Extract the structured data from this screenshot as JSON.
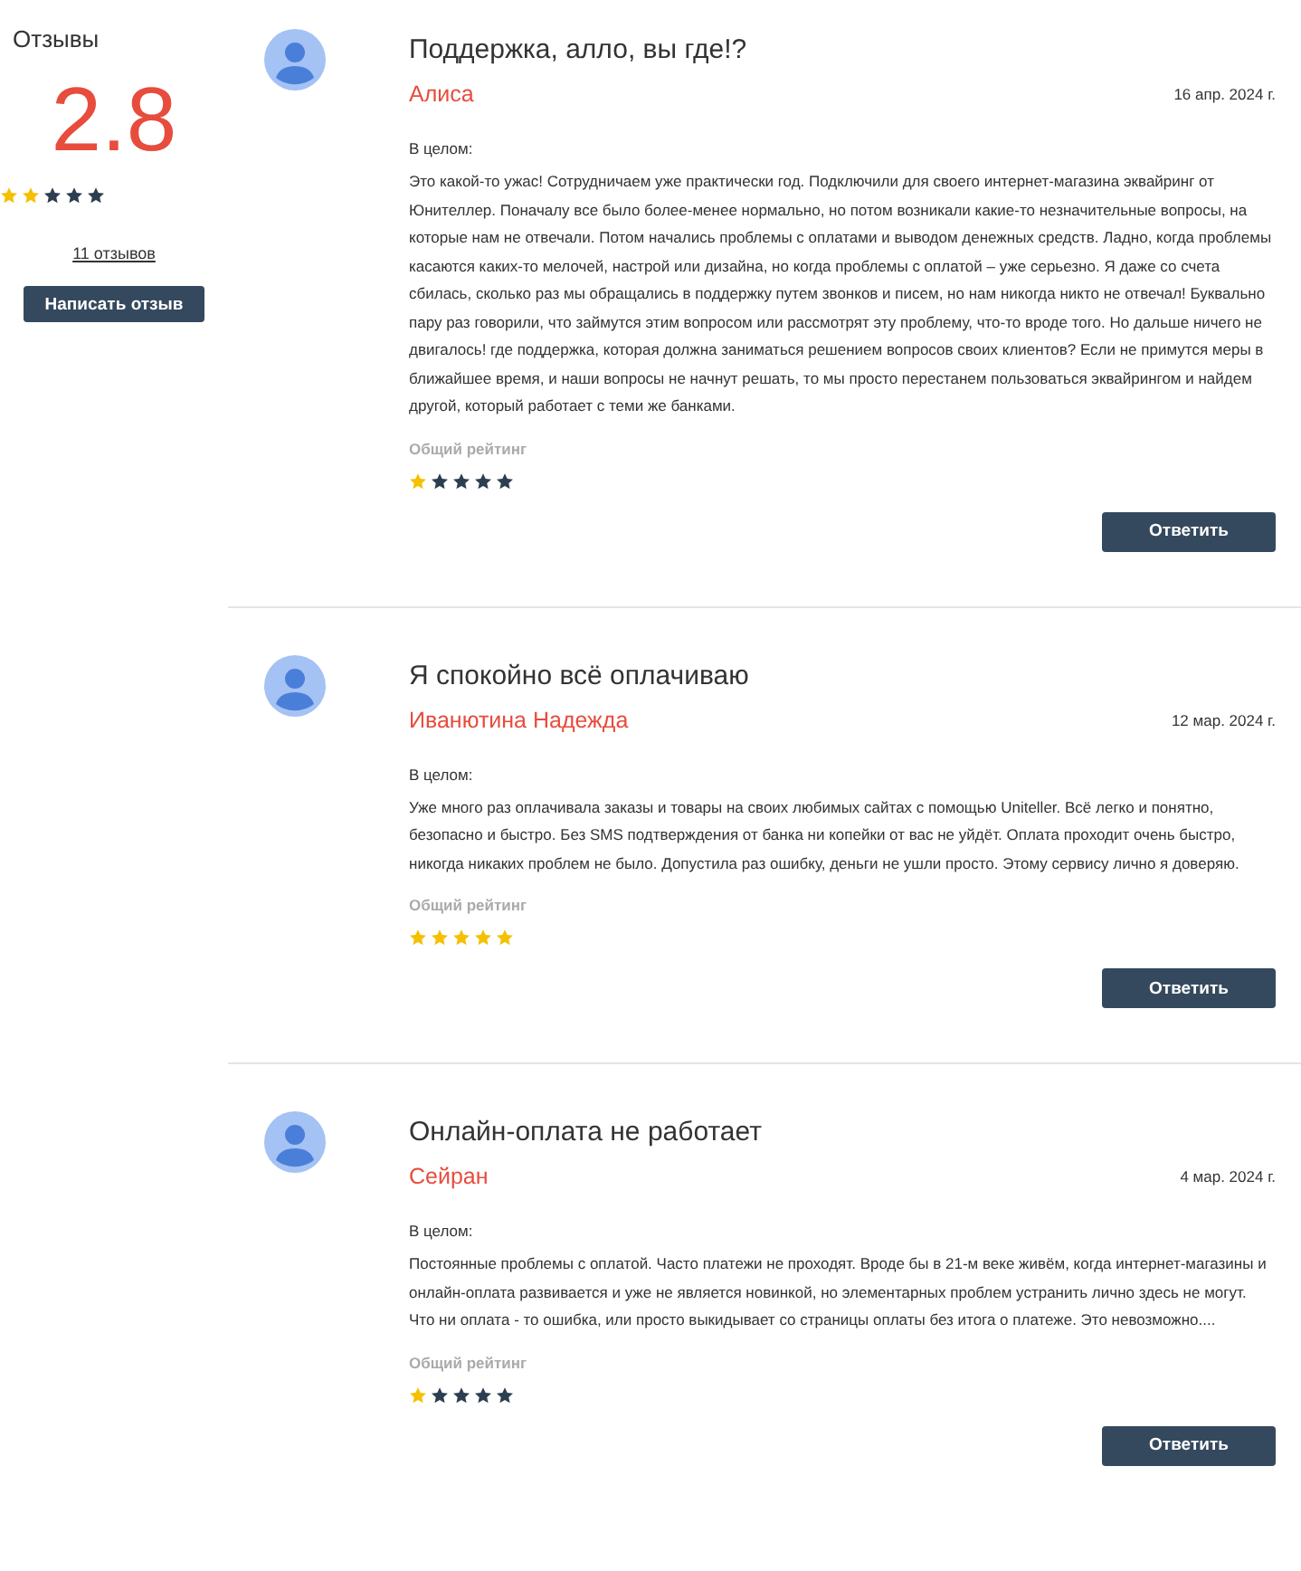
{
  "summary": {
    "title": "Отзывы",
    "score": "2.8",
    "stars": 2,
    "count_link": "11 отзывов",
    "write_button": "Написать отзыв"
  },
  "reviews": [
    {
      "title": "Поддержка, алло, вы где!?",
      "author": "Алиса",
      "date": "16 апр. 2024 г.",
      "section": "В целом:",
      "text": "Это какой-то ужас! Сотрудничаем уже практически год. Подключили для своего интернет-магазина эквайринг от Юнителлер. Поначалу все было более-менее нормально, но потом возникали какие-то незначительные вопросы, на которые нам не отвечали. Потом начались проблемы с оплатами и выводом денежных средств. Ладно, когда проблемы касаются каких-то мелочей, настрой или дизайна, но когда проблемы с оплатой – уже серьезно. Я даже со счета сбилась, сколько раз мы обращались в поддержку путем звонков и писем, но нам никогда никто не отвечал! Буквально пару раз говорили, что займутся этим вопросом или рассмотрят эту проблему, что-то вроде того. Но дальше ничего не двигалось! где поддержка, которая должна заниматься решением вопросов своих клиентов? Если не примутся меры в ближайшее время, и наши вопросы не начнут решать, то мы просто перестанем пользоваться эквайрингом и найдем другой, который работает с теми же банками.",
      "rating_label": "Общий рейтинг",
      "stars": 1,
      "reply_button": "Ответить"
    },
    {
      "title": "Я спокойно всё оплачиваю",
      "author": "Иванютина Надежда",
      "date": "12 мар. 2024 г.",
      "section": "В целом:",
      "text": "Уже много раз оплачивала заказы и товары на своих любимых сайтах с помощью Uniteller. Всё легко и понятно, безопасно и быстро. Без SMS подтверждения от банка ни копейки от вас не уйдёт. Оплата проходит очень быстро, никогда никаких проблем не было. Допустила раз ошибку, деньги не ушли просто. Этому сервису лично я доверяю.",
      "rating_label": "Общий рейтинг",
      "stars": 5,
      "reply_button": "Ответить"
    },
    {
      "title": "Онлайн-оплата не работает",
      "author": "Сейран",
      "date": "4 мар. 2024 г.",
      "section": "В целом:",
      "text": "Постоянные проблемы с оплатой. Часто платежи не проходят. Вроде бы в 21-м веке живём, когда интернет-магазины и онлайн-оплата развивается и уже не является новинкой, но элементарных проблем устранить лично здесь не могут. Что ни оплата - то ошибка, или просто выкидывает со страницы оплаты без итога о платеже. Это невозможно....",
      "rating_label": "Общий рейтинг",
      "stars": 1,
      "reply_button": "Ответить"
    }
  ]
}
